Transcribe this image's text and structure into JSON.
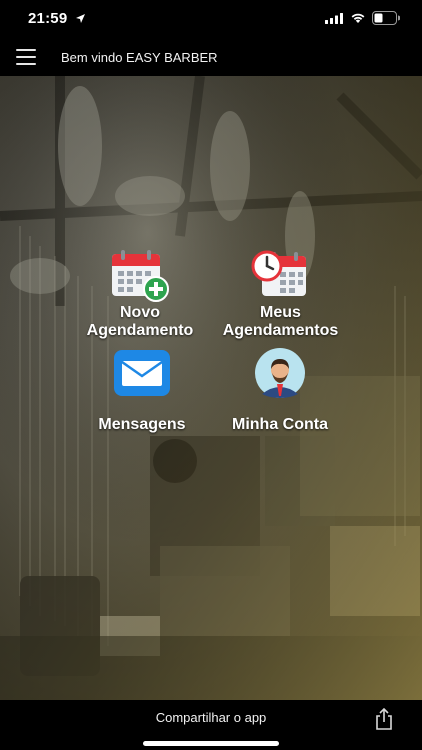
{
  "status_bar": {
    "time": "21:59",
    "icons": [
      "location-arrow-icon",
      "signal-icon",
      "wifi-icon",
      "battery-icon"
    ]
  },
  "nav": {
    "title": "Bem vindo EASY BARBER",
    "menu_icon": "hamburger-menu-icon"
  },
  "tiles": [
    {
      "label": "Novo\nAgendamento",
      "icon": "calendar-add-icon"
    },
    {
      "label": "Meus\nAgendamentos",
      "icon": "calendar-clock-icon"
    },
    {
      "label": "Mensagens",
      "icon": "envelope-icon"
    },
    {
      "label": "Minha Conta",
      "icon": "user-avatar-icon"
    }
  ],
  "footer": {
    "share_label": "Compartilhar o app",
    "share_icon": "share-icon"
  },
  "colors": {
    "background": "#000000",
    "hero_tint": "#5c5a4e",
    "calendar_red": "#e5333a",
    "plus_green": "#2ea44f",
    "envelope_blue": "#1e88e5",
    "avatar_bg": "#b9e3ef"
  }
}
